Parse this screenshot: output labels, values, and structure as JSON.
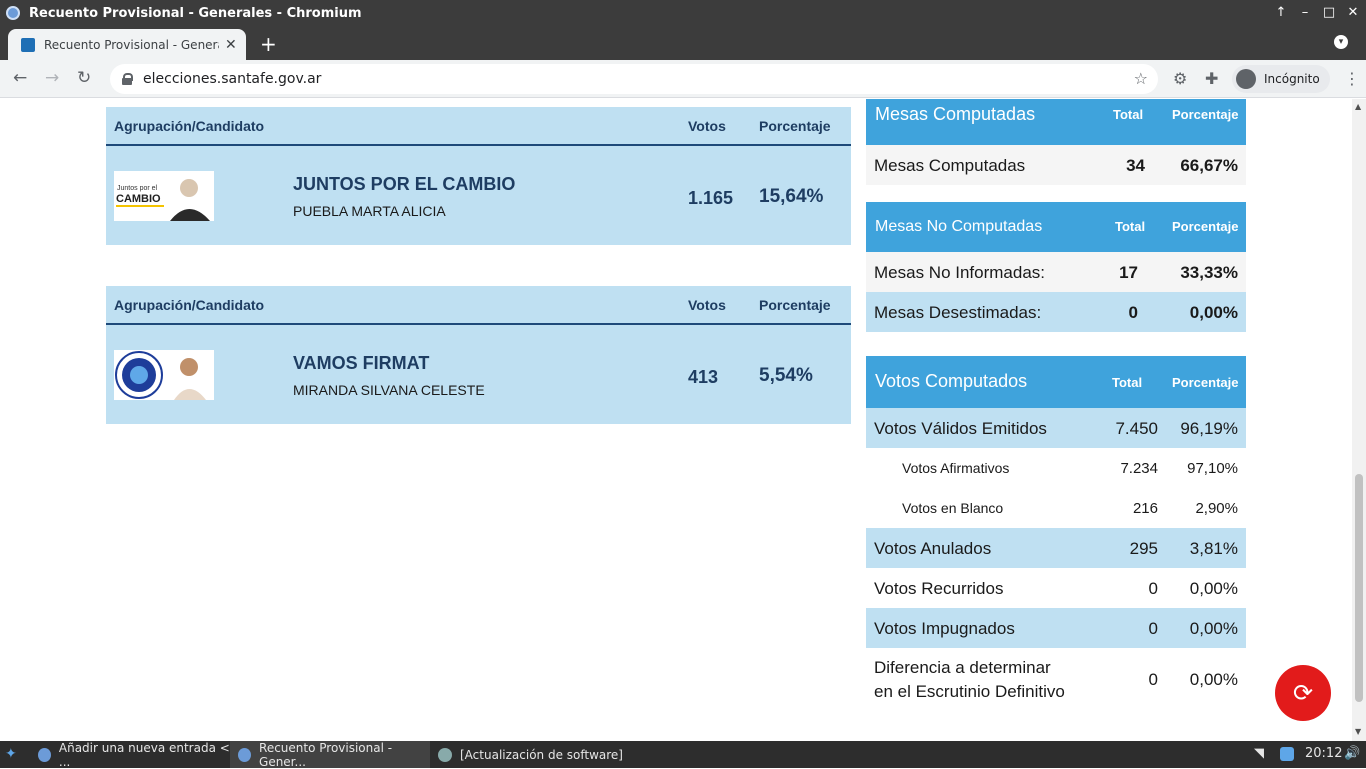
{
  "window": {
    "title": "Recuento Provisional - Generales - Chromium",
    "controls": [
      "↑",
      "–",
      "□",
      "✕"
    ]
  },
  "tab": {
    "title": "Recuento Provisional - Generales",
    "close": "✕",
    "new": "+"
  },
  "toolbar": {
    "back": "←",
    "forward": "→",
    "reload": "↻",
    "url": "elecciones.santafe.gov.ar",
    "star": "☆",
    "incognito_label": "Incógnito",
    "menu": "⋮"
  },
  "headers": {
    "party": "Agrupación/Candidato",
    "votes": "Votos",
    "percent": "Porcentaje"
  },
  "candidates": [
    {
      "party": "JUNTOS POR EL CAMBIO",
      "candidate": "PUEBLA MARTA ALICIA",
      "votes": "1.165",
      "percent": "15,64%",
      "logo_text": "Juntos por el\nCAMBIO"
    },
    {
      "party": "VAMOS FIRMAT",
      "candidate": "MIRANDA SILVANA CELESTE",
      "votes": "413",
      "percent": "5,54%"
    }
  ],
  "mesas_computadas": {
    "title": "Mesas Computadas",
    "col_total": "Total",
    "col_percent": "Porcentaje",
    "rows": [
      {
        "label": "Mesas Computadas",
        "total": "34",
        "percent": "66,67%"
      }
    ]
  },
  "mesas_no_computadas": {
    "title": "Mesas No Computadas",
    "col_total": "Total",
    "col_percent": "Porcentaje",
    "rows": [
      {
        "label": "Mesas No Informadas:",
        "total": "17",
        "percent": "33,33%"
      },
      {
        "label": "Mesas Desestimadas:",
        "total": "0",
        "percent": "0,00%"
      }
    ]
  },
  "votos_computados": {
    "title": "Votos Computados",
    "col_total": "Total",
    "col_percent": "Porcentaje",
    "rows": [
      {
        "label": "Votos Válidos Emitidos",
        "total": "7.450",
        "percent": "96,19%"
      },
      {
        "label": "Votos Afirmativos",
        "total": "7.234",
        "percent": "97,10%"
      },
      {
        "label": "Votos en Blanco",
        "total": "216",
        "percent": "2,90%"
      },
      {
        "label": "Votos Anulados",
        "total": "295",
        "percent": "3,81%"
      },
      {
        "label": "Votos Recurridos",
        "total": "0",
        "percent": "0,00%"
      },
      {
        "label": "Votos Impugnados",
        "total": "0",
        "percent": "0,00%"
      },
      {
        "label": "Diferencia a determinar",
        "label2": "en el Escrutinio Definitivo",
        "total": "0",
        "percent": "0,00%"
      }
    ]
  },
  "refresh_icon": "⟳",
  "taskbar": {
    "tasks": [
      "Añadir una nueva entrada < ...",
      "Recuento Provisional - Gener...",
      "[Actualización de software]"
    ],
    "clock": "20:12"
  },
  "colors": {
    "header_blue": "#3fa3dc",
    "row_blue": "#bfe0f2",
    "fab_red": "#e21b1b"
  }
}
